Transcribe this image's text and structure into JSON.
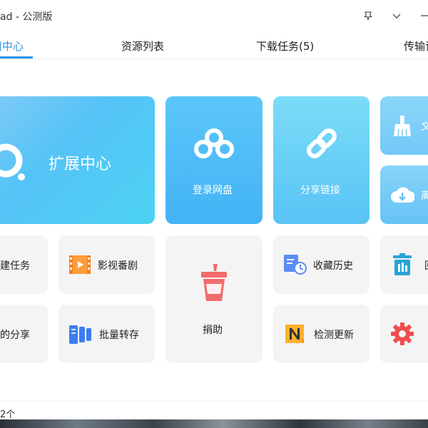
{
  "window": {
    "title": "ad - 公测版"
  },
  "tabs": [
    {
      "label": "用中心",
      "active": true
    },
    {
      "label": "资源列表",
      "active": false
    },
    {
      "label": "下载任务(5)",
      "active": false
    },
    {
      "label": "传输记",
      "active": false
    }
  ],
  "tiles": {
    "extension_center": "扩展中心",
    "login_netdisk": "登录网盘",
    "share_link": "分享链接",
    "right_top_1": "文",
    "right_top_2": "离",
    "new_task": "建任务",
    "video": "影视番剧",
    "donate": "捐助",
    "favorites_history": "收藏历史",
    "right_mid": "回",
    "my_share": "的分享",
    "batch_transfer": "批量转存",
    "check_update": "检测更新"
  },
  "status": {
    "text": "2个"
  },
  "colors": {
    "accent": "#2a95e6",
    "tile_gray": "#f4f4f5",
    "donate_red": "#f26b6b"
  },
  "icons": [
    "pin-icon",
    "chevron-down-icon",
    "minimize-icon",
    "search-ring-icon",
    "cloud-icon",
    "link-icon",
    "broom-icon",
    "cloud-download-icon",
    "film-icon",
    "cup-icon",
    "history-icon",
    "recycle-bin-icon",
    "batch-icon",
    "update-icon",
    "gear-icon"
  ]
}
